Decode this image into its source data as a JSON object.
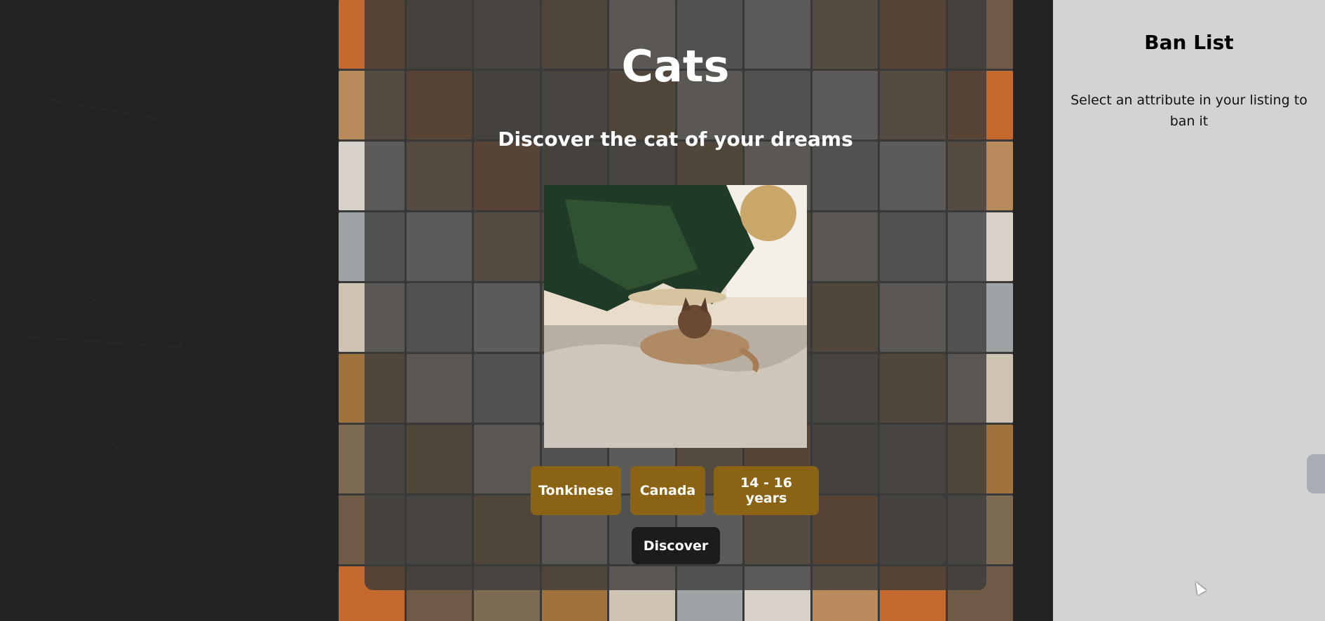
{
  "header": {
    "title": "Cats",
    "subtitle": "Discover the cat of your dreams"
  },
  "listing": {
    "image_alt": "Tonkinese cat under a Christmas tree",
    "attributes": [
      "Tonkinese",
      "Canada",
      "14 - 16 years"
    ]
  },
  "actions": {
    "discover_label": "Discover"
  },
  "ban_list": {
    "title": "Ban List",
    "hint": "Select an attribute in your listing to ban it"
  },
  "colors": {
    "attribute_button": "#8a6414",
    "discover_button": "#1c1c1c",
    "side_panel": "#d3d3d3",
    "page_background": "#232323"
  }
}
